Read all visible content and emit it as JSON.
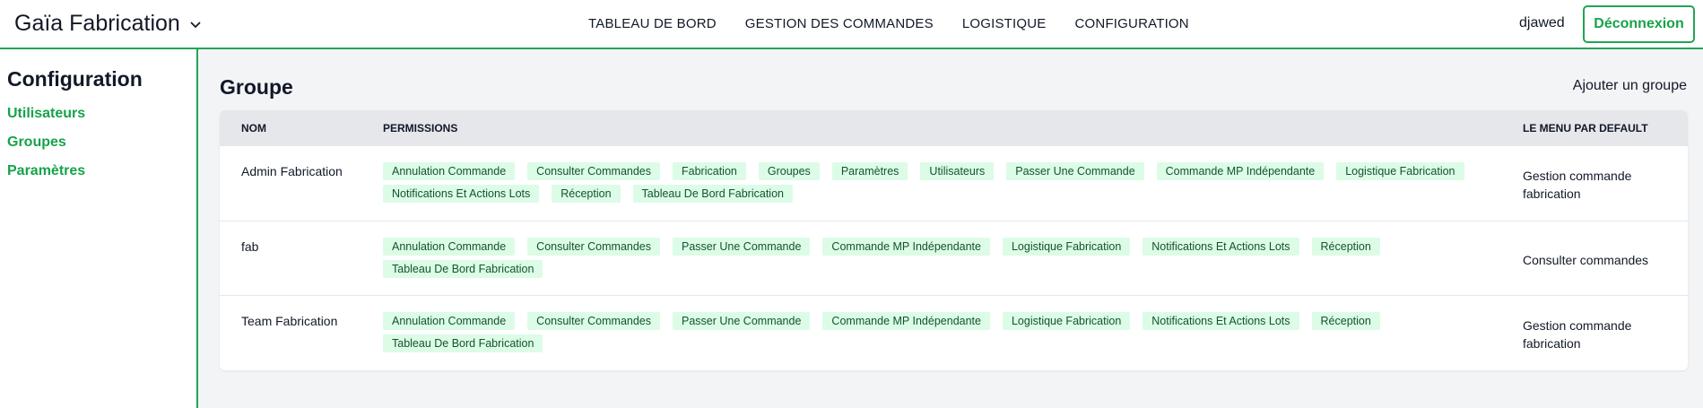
{
  "header": {
    "brand": "Gaïa Fabrication",
    "nav": [
      "TABLEAU DE BORD",
      "GESTION DES COMMANDES",
      "LOGISTIQUE",
      "CONFIGURATION"
    ],
    "user": "djawed",
    "logout_label": "Déconnexion"
  },
  "sidebar": {
    "title": "Configuration",
    "items": [
      {
        "label": "Utilisateurs"
      },
      {
        "label": "Groupes"
      },
      {
        "label": "Paramètres"
      }
    ]
  },
  "main": {
    "title": "Groupe",
    "add_label": "Ajouter un groupe",
    "columns": {
      "name": "NOM",
      "permissions": "PERMISSIONS",
      "default_menu": "LE MENU PAR DEFAULT"
    },
    "rows": [
      {
        "name": "Admin Fabrication",
        "permissions": [
          "Annulation Commande",
          "Consulter Commandes",
          "Fabrication",
          "Groupes",
          "Paramètres",
          "Utilisateurs",
          "Passer Une Commande",
          "Commande MP Indépendante",
          "Logistique Fabrication",
          "Notifications Et Actions Lots",
          "Réception",
          "Tableau De Bord Fabrication"
        ],
        "menu": "Gestion commande fabrication"
      },
      {
        "name": "fab",
        "permissions": [
          "Annulation Commande",
          "Consulter Commandes",
          "Passer Une Commande",
          "Commande MP Indépendante",
          "Logistique Fabrication",
          "Notifications Et Actions Lots",
          "Réception",
          "Tableau De Bord Fabrication"
        ],
        "menu": "Consulter commandes"
      },
      {
        "name": "Team Fabrication",
        "permissions": [
          "Annulation Commande",
          "Consulter Commandes",
          "Passer Une Commande",
          "Commande MP Indépendante",
          "Logistique Fabrication",
          "Notifications Et Actions Lots",
          "Réception",
          "Tableau De Bord Fabrication"
        ],
        "menu": "Gestion commande fabrication"
      }
    ]
  }
}
